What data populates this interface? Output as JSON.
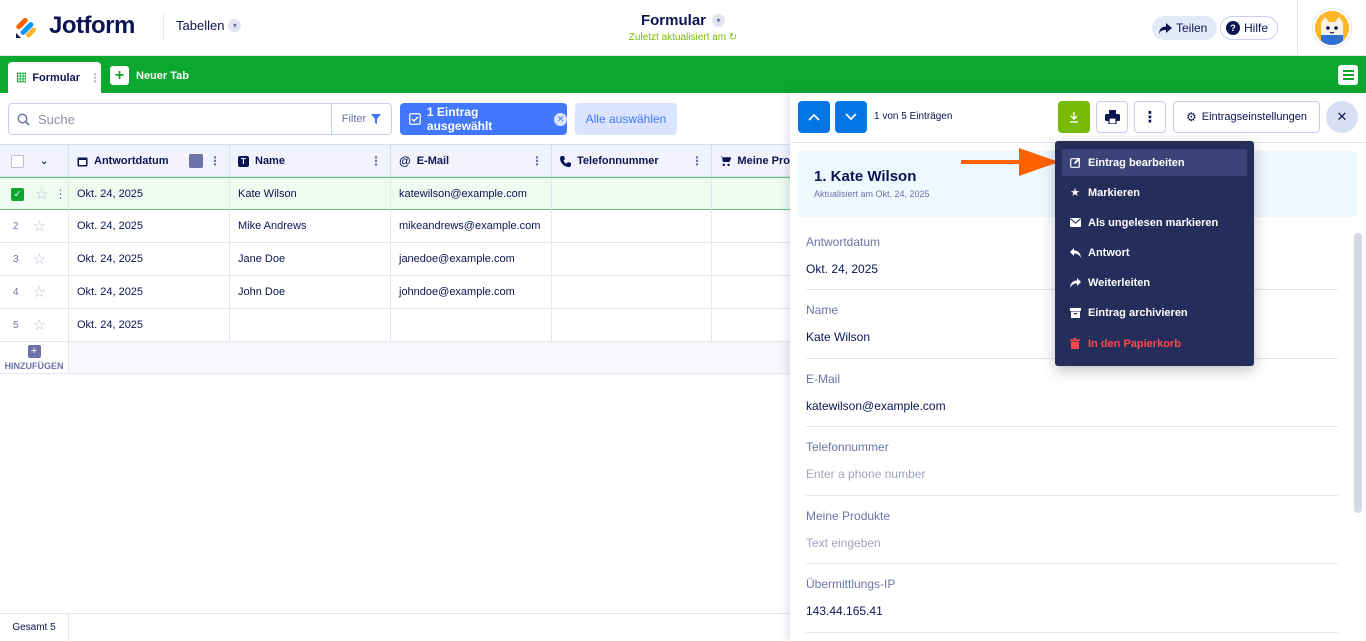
{
  "header": {
    "logo_text": "Jotform",
    "tables_label": "Tabellen",
    "form_title": "Formular",
    "last_updated": "Zuletzt aktualisiert am",
    "share_label": "Teilen",
    "help_label": "Hilfe"
  },
  "tabs": {
    "active_label": "Formular",
    "new_tab_label": "Neuer Tab"
  },
  "toolbar": {
    "search_placeholder": "Suche",
    "filter_label": "Filter",
    "selected_label": "1 Eintrag ausgewählt",
    "select_all_label": "Alle auswählen"
  },
  "table": {
    "columns": [
      "Antwortdatum",
      "Name",
      "E-Mail",
      "Telefonnummer",
      "Meine Pro"
    ],
    "rows": [
      {
        "num": "",
        "date": "Okt. 24, 2025",
        "name": "Kate Wilson",
        "email": "katewilson@example.com",
        "selected": true
      },
      {
        "num": "2",
        "date": "Okt. 24, 2025",
        "name": "Mike Andrews",
        "email": "mikeandrews@example.com",
        "selected": false
      },
      {
        "num": "3",
        "date": "Okt. 24, 2025",
        "name": "Jane Doe",
        "email": "janedoe@example.com",
        "selected": false
      },
      {
        "num": "4",
        "date": "Okt. 24, 2025",
        "name": "John Doe",
        "email": "johndoe@example.com",
        "selected": false
      },
      {
        "num": "5",
        "date": "Okt. 24, 2025",
        "name": "",
        "email": "",
        "selected": false
      }
    ],
    "add_label": "HINZUFÜGEN",
    "total_label": "Gesamt 5"
  },
  "panel": {
    "count_label": "1 von 5 Einträgen",
    "settings_label": "Eintragseinstellungen",
    "entry_title": "1. Kate Wilson",
    "entry_updated": "Aktualisiert am Okt. 24, 2025",
    "fields": [
      {
        "label": "Antwortdatum",
        "value": "Okt. 24, 2025",
        "placeholder": false
      },
      {
        "label": "Name",
        "value": "Kate Wilson",
        "placeholder": false
      },
      {
        "label": "E-Mail",
        "value": "katewilson@example.com",
        "placeholder": false
      },
      {
        "label": "Telefonnummer",
        "value": "Enter a phone number",
        "placeholder": true
      },
      {
        "label": "Meine Produkte",
        "value": "Text eingeben",
        "placeholder": true
      },
      {
        "label": "Übermittlungs-IP",
        "value": "143.44.165.41",
        "placeholder": false
      }
    ]
  },
  "menu": {
    "items": [
      {
        "label": "Eintrag bearbeiten",
        "icon": "edit-icon"
      },
      {
        "label": "Markieren",
        "icon": "star-icon"
      },
      {
        "label": "Als ungelesen markieren",
        "icon": "envelope-icon"
      },
      {
        "label": "Antwort",
        "icon": "reply-icon"
      },
      {
        "label": "Weiterleiten",
        "icon": "forward-icon"
      },
      {
        "label": "Eintrag archivieren",
        "icon": "archive-icon"
      },
      {
        "label": "In den Papierkorb",
        "icon": "trash-icon"
      }
    ]
  },
  "colors": {
    "brand_green": "#0ca72f",
    "primary_blue": "#0075e3",
    "chip_blue": "#4277ff",
    "menu_bg": "#252d5b",
    "danger_red": "#ff4948",
    "arrow_orange": "#ff6100"
  }
}
